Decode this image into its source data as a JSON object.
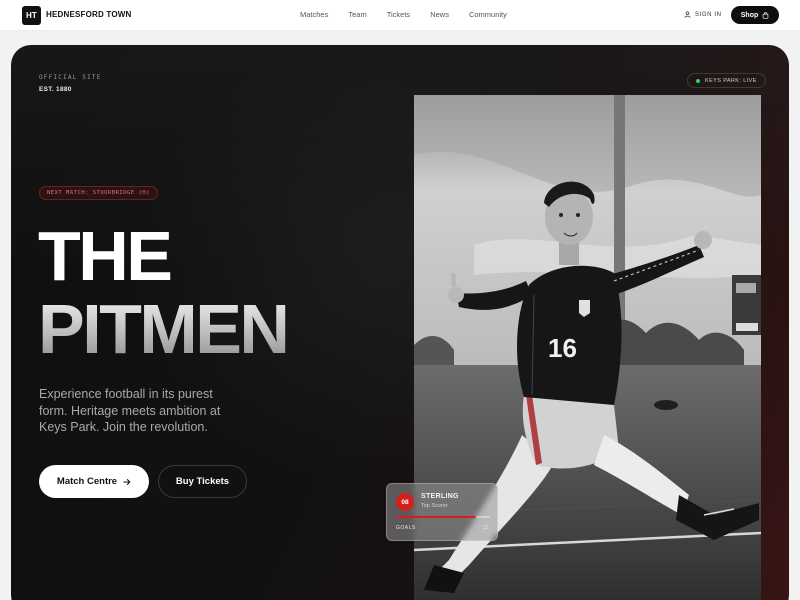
{
  "nav": {
    "logo_mark": "HT",
    "logo_text": "HEDNESFORD TOWN",
    "links": [
      "Matches",
      "Team",
      "Tickets",
      "News",
      "Community"
    ],
    "signin_label": "SIGN IN",
    "shop_label": "Shop"
  },
  "hero": {
    "official_label": "OFFICIAL SITE",
    "est_label": "EST. 1880",
    "live_label": "KEYS PARK: LIVE",
    "next_match": "NEXT MATCH: STOURBRIDGE (H)",
    "title_line1": "THE",
    "title_line2": "PITMEN",
    "tagline": "Experience football in its purest form. Heritage meets ambition at Keys Park. Join the revolution.",
    "primary_button": "Match Centre",
    "secondary_button": "Buy Tickets"
  },
  "photo": {
    "jersey_number": "16"
  },
  "stat_card": {
    "badge": "08",
    "name": "STERLING",
    "role": "Top Scorer",
    "metric_label": "GOALS",
    "metric_value": "12",
    "progress": 0.85
  },
  "colors": {
    "accent_red": "#d2201f",
    "live_green": "#3ccf5a",
    "dark": "#111111"
  },
  "icons": {
    "user": "user-icon",
    "bag": "bag-icon",
    "arrow": "arrow-right-icon"
  }
}
